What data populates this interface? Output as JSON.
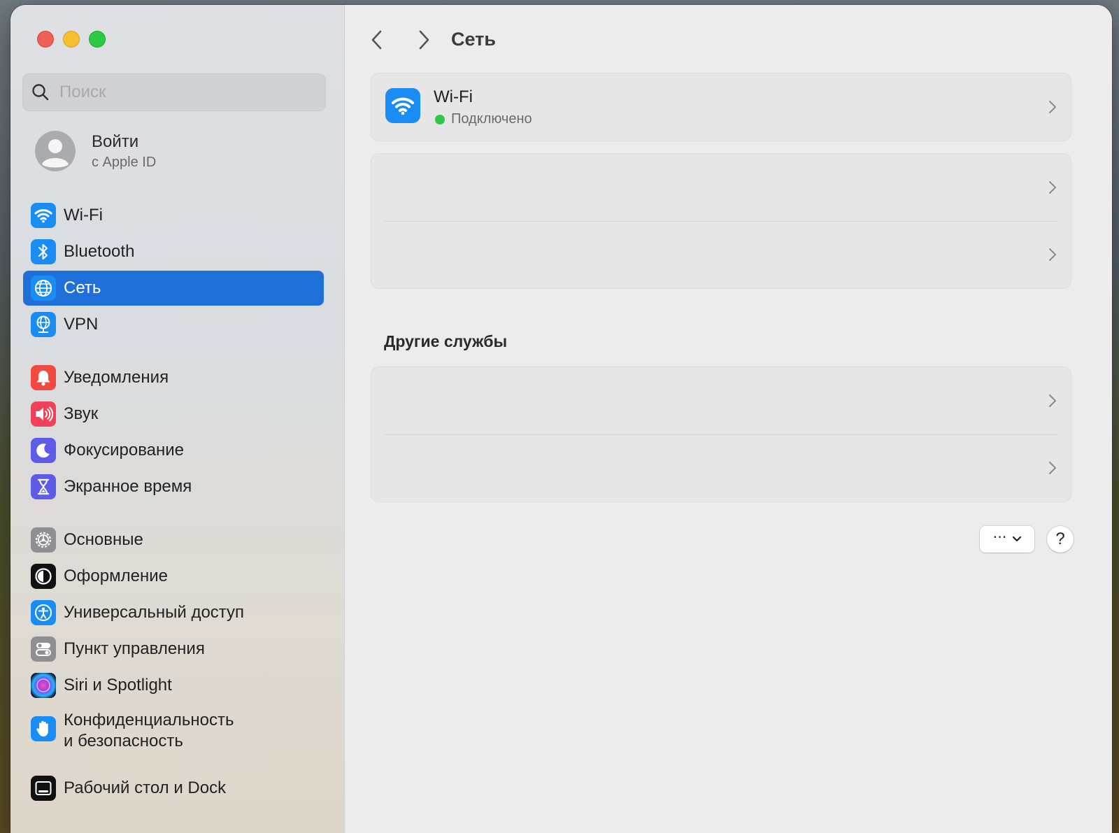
{
  "window": {
    "title": "Сеть"
  },
  "sidebar": {
    "search_placeholder": "Поиск",
    "account": {
      "title": "Войти",
      "subtitle": "с Apple ID"
    },
    "items": [
      {
        "label": "Wi-Fi",
        "icon": "wifi-icon",
        "color": "#1a8df5"
      },
      {
        "label": "Bluetooth",
        "icon": "bluetooth-icon",
        "color": "#1a8df5"
      },
      {
        "label": "Сеть",
        "icon": "globe-icon",
        "color": "#1a8df5",
        "active": true
      },
      {
        "label": "VPN",
        "icon": "vpn-globe-icon",
        "color": "#1a8df5"
      },
      {
        "label": "Уведомления",
        "icon": "bell-icon",
        "color": "#f04a43"
      },
      {
        "label": "Звук",
        "icon": "speaker-icon",
        "color": "#f0405a"
      },
      {
        "label": "Фокусирование",
        "icon": "moon-icon",
        "color": "#5e5ce6"
      },
      {
        "label": "Экранное время",
        "icon": "hourglass-icon",
        "color": "#5e5ce6"
      },
      {
        "label": "Основные",
        "icon": "gear-icon",
        "color": "#8e8e93"
      },
      {
        "label": "Оформление",
        "icon": "appearance-icon",
        "color": "#111111"
      },
      {
        "label": "Универсальный доступ",
        "icon": "accessibility-icon",
        "color": "#1a8df5"
      },
      {
        "label": "Пункт управления",
        "icon": "control-center-icon",
        "color": "#8e8e93"
      },
      {
        "label": "Siri и Spotlight",
        "icon": "siri-icon",
        "color": "#2a2a5e"
      },
      {
        "label": "Конфиденциальность и безопасность",
        "label_line1": "Конфиденциальность",
        "label_line2": "и безопасность",
        "icon": "hand-icon",
        "color": "#1a8df5"
      },
      {
        "label": "Рабочий стол и Dock",
        "icon": "dock-icon",
        "color": "#111111"
      }
    ]
  },
  "main": {
    "title": "Сеть",
    "wifi": {
      "title": "Wi-Fi",
      "status": "Подключено",
      "status_color": "#2ec748"
    },
    "section_other": "Другие службы",
    "more_button": "⋯",
    "help_button": "?"
  }
}
